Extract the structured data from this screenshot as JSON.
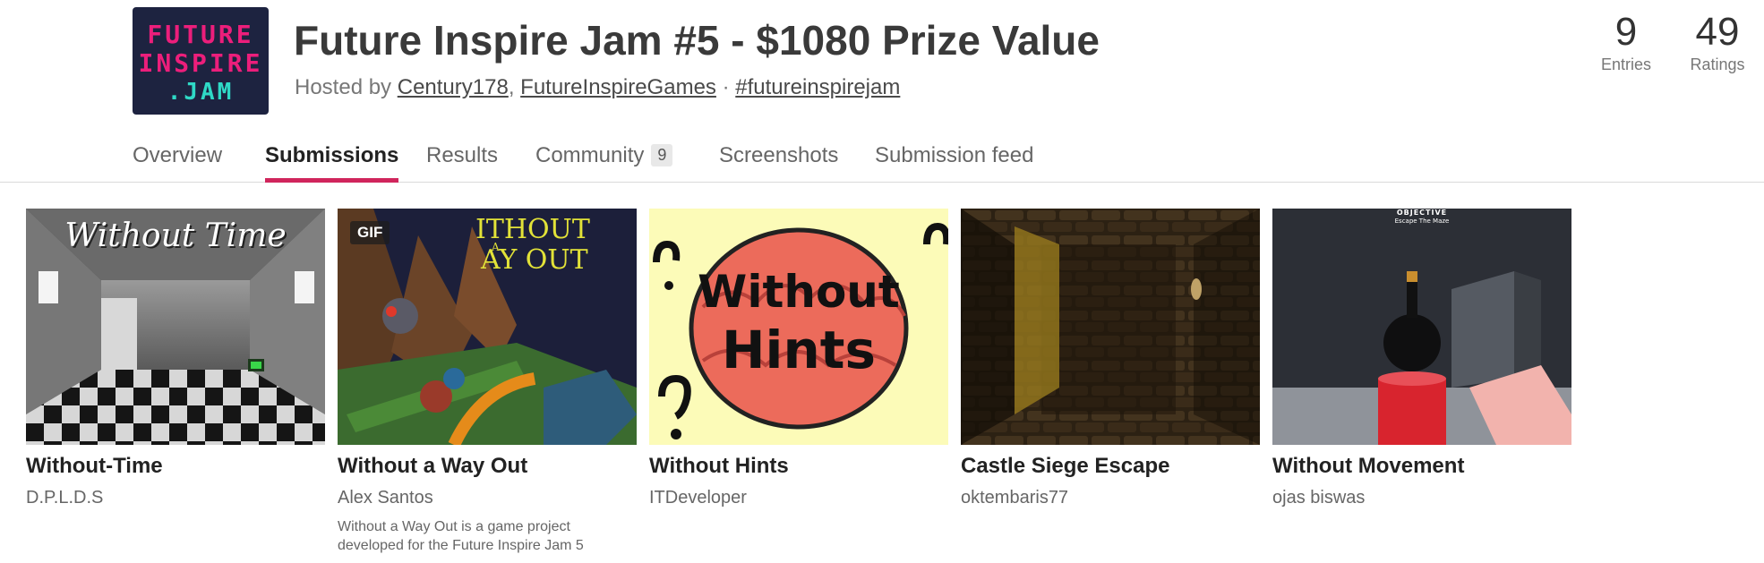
{
  "jam": {
    "logo_lines": [
      "FUTURE",
      "INSPIRE",
      ".JAM"
    ],
    "title": "Future Inspire Jam #5 - $1080 Prize Value",
    "hosted_prefix": "Hosted by",
    "hosts": [
      "Century178",
      "FutureInspireGames"
    ],
    "separator": "·",
    "hashtag": "#futureinspirejam"
  },
  "stats": {
    "entries_value": "9",
    "entries_label": "Entries",
    "ratings_value": "49",
    "ratings_label": "Ratings"
  },
  "tabs": [
    {
      "label": "Overview"
    },
    {
      "label": "Submissions",
      "active": true
    },
    {
      "label": "Results"
    },
    {
      "label": "Community",
      "badge": "9"
    },
    {
      "label": "Screenshots"
    },
    {
      "label": "Submission feed"
    }
  ],
  "submissions": [
    {
      "title": "Without-Time",
      "author": "D.P.L.D.S",
      "thumb_text": "Without Time"
    },
    {
      "title": "Without a Way Out",
      "author": "Alex Santos",
      "badge": "GIF",
      "thumb_text_1": "ITHOUT",
      "thumb_text_2": "AY OUT",
      "thumb_text_a": "A",
      "description": "Without a Way Out is a game project developed for the Future Inspire Jam 5"
    },
    {
      "title": "Without Hints",
      "author": "ITDeveloper",
      "thumb_text_1": "Without",
      "thumb_text_2": "Hints"
    },
    {
      "title": "Castle Siege Escape",
      "author": "oktembaris77"
    },
    {
      "title": "Without Movement",
      "author": "ojas biswas",
      "thumb_text_1": "OBJECTIVE",
      "thumb_text_2": "Escape The Maze"
    }
  ],
  "colors": {
    "accent": "#d0255c",
    "logo_bg": "#1d2340",
    "logo_pink": "#ec1e7b",
    "logo_teal": "#2fd9c6"
  }
}
